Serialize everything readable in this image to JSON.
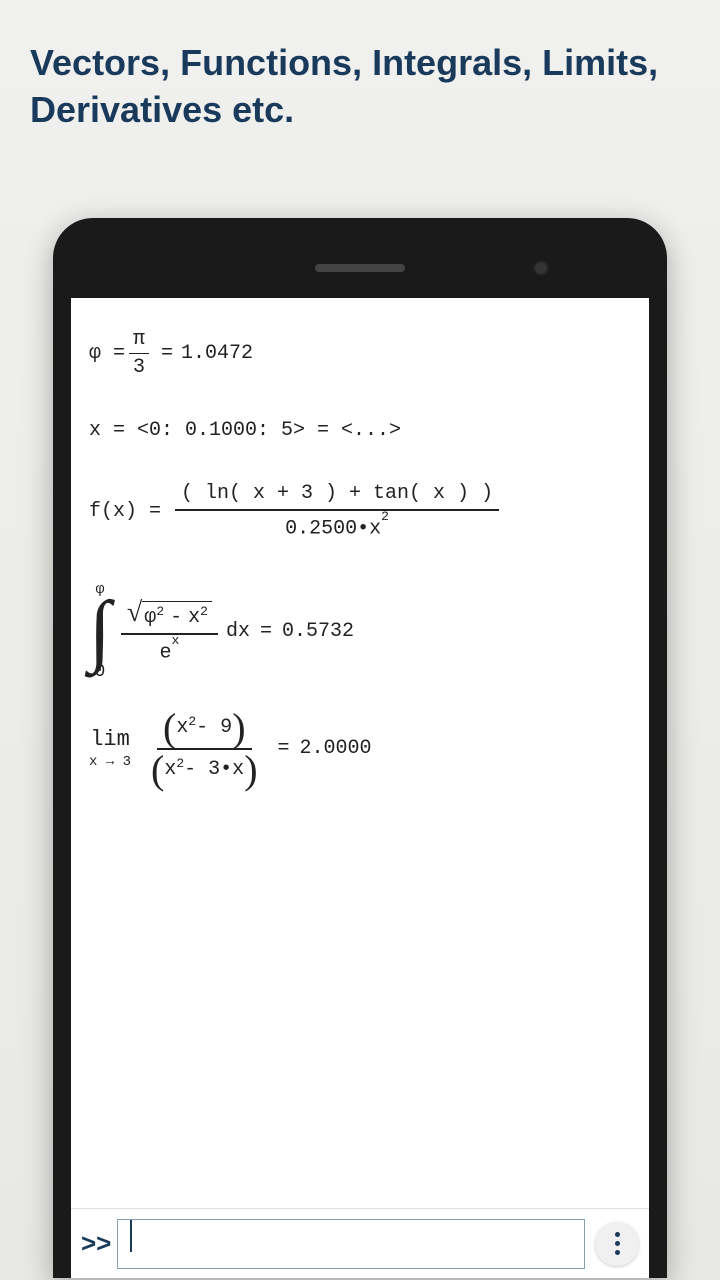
{
  "headline": "Vectors, Functions, Integrals, Limits, Derivatives etc.",
  "eq1": {
    "lhs": "φ =",
    "frac_num": "π",
    "frac_den": "3",
    "eq": "=",
    "val": "1.0472"
  },
  "eq2": {
    "text": "x = <0: 0.1000: 5> = <...>"
  },
  "eq3": {
    "lhs": "f(x) =",
    "num": "( ln( x + 3 ) + tan( x ) )",
    "den_base": "0.2500•x",
    "den_exp": "2"
  },
  "eq4": {
    "upper": "φ",
    "lower": "0",
    "sqrt_a": "φ",
    "sqrt_a_exp": "2",
    "sqrt_op": "-",
    "sqrt_b": "x",
    "sqrt_b_exp": "2",
    "den_base": "e",
    "den_exp": "x",
    "dx": "dx",
    "eq": "=",
    "val": "0.5732"
  },
  "eq5": {
    "lim": "lim",
    "sub": "x → 3",
    "num_a": "x",
    "num_a_exp": "2",
    "num_rest": " - 9",
    "den_a": "x",
    "den_a_exp": "2",
    "den_rest": " - 3•x",
    "eq": "=",
    "val": "2.0000"
  },
  "input": {
    "prompt": ">>",
    "value": ""
  }
}
